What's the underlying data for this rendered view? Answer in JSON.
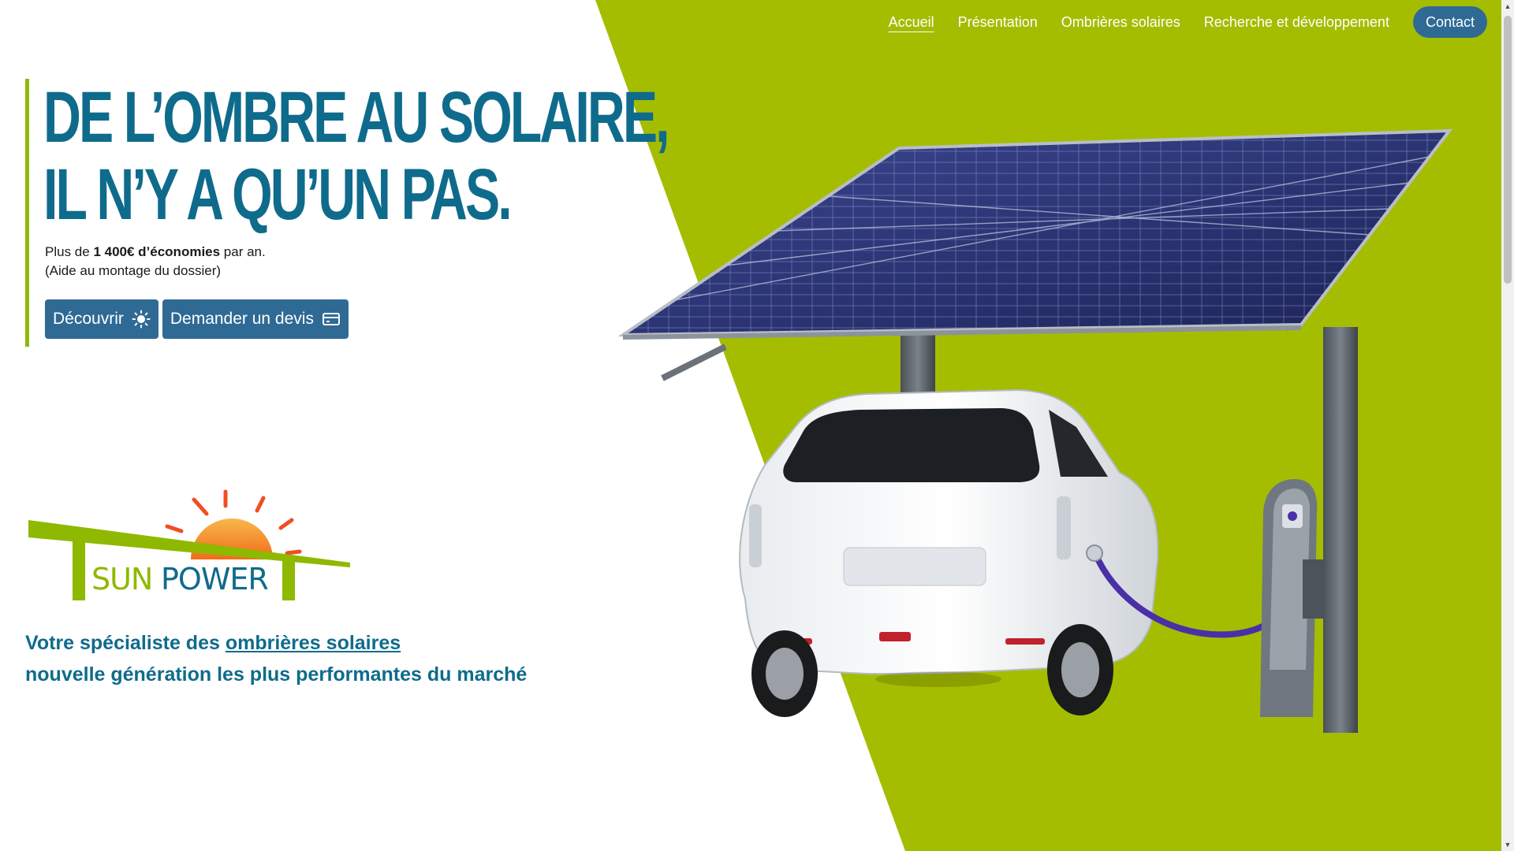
{
  "nav": {
    "items": [
      "Accueil",
      "Présentation",
      "Ombrières solaires",
      "Recherche et développement"
    ],
    "contact": "Contact"
  },
  "hero": {
    "headline_line1": "DE L’OMBRE AU SOLAIRE,",
    "headline_line2": "IL N’Y A QU’UN PAS.",
    "sub_prefix": "Plus de ",
    "sub_bold": "1 400€ d’économies",
    "sub_suffix": " par an.",
    "sub_line2": "(Aide au montage du dossier)",
    "btn_discover": "Découvrir",
    "btn_quote": "Demander un devis"
  },
  "logo": {
    "text_sun": "SUN",
    "text_power": "POWER"
  },
  "tagline": {
    "prefix": "Votre spécialiste des ",
    "link": "ombrières solaires",
    "line2": "nouvelle génération les plus performantes du marché"
  },
  "colors": {
    "green": "#a4bd00",
    "blue": "#0f6b8c",
    "button": "#2f6a94"
  },
  "icons": [
    "sun-icon",
    "credit-card-icon"
  ]
}
